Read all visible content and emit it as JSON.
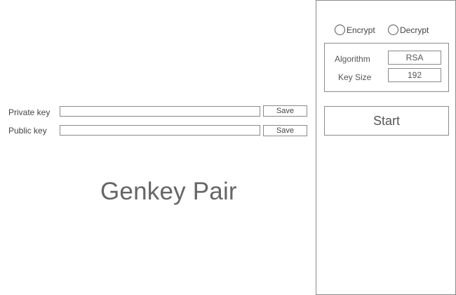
{
  "keys": {
    "private": {
      "label": "Private key",
      "value": "",
      "save_label": "Save"
    },
    "public": {
      "label": "Public key",
      "value": "",
      "save_label": "Save"
    }
  },
  "title": "Genkey Pair",
  "mode": {
    "options": [
      {
        "label": "Encrypt",
        "selected": false
      },
      {
        "label": "Decrypt",
        "selected": false
      }
    ]
  },
  "params": {
    "algorithm": {
      "label": "Algorithm",
      "value": "RSA"
    },
    "key_size": {
      "label": "Key Size",
      "value": "192"
    }
  },
  "start_label": "Start"
}
